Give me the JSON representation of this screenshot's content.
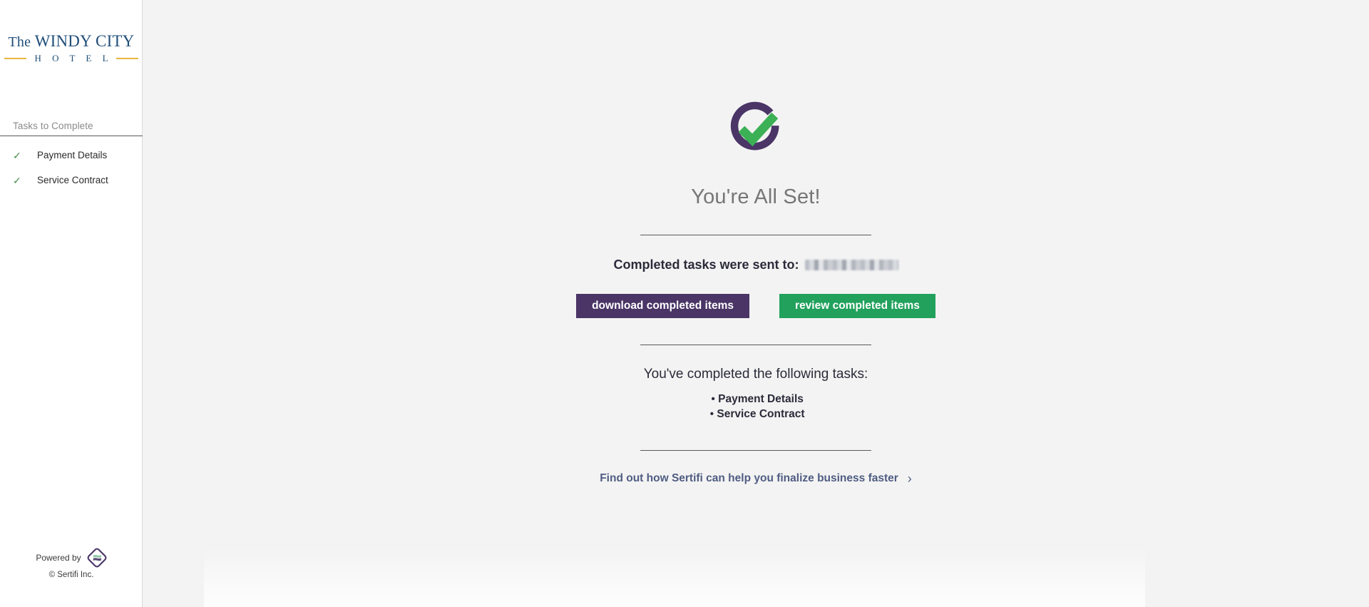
{
  "sidebar": {
    "brand": {
      "the": "The",
      "name": "WINDY CITY",
      "subtitle": "H O T E L",
      "color": "#1f4e79",
      "rule_color": "#e8b73c"
    },
    "tasks_header": "Tasks to Complete",
    "items": [
      {
        "label": "Payment Details",
        "icon": "check-icon",
        "state": "completed"
      },
      {
        "label": "Service Contract",
        "icon": "check-icon",
        "state": "completed"
      }
    ],
    "footer": {
      "powered_by": "Powered by",
      "logo_name": "sertifi-logo-icon",
      "copyright": "© Sertifi Inc."
    }
  },
  "main": {
    "status_icon": "circle-check-icon",
    "headline": "You're All Set!",
    "sent_to_label": "Completed tasks were sent to:",
    "sent_to_value": "",
    "buttons": {
      "download": {
        "label": "download completed items",
        "color": "#4a3566"
      },
      "review": {
        "label": "review completed items",
        "color": "#21a15c"
      }
    },
    "completed_title": "You've completed the following tasks:",
    "completed_items": [
      "Payment Details",
      "Service Contract"
    ],
    "promo": {
      "text": "Find out how Sertifi can help you finalize business faster",
      "chevron": "›",
      "color": "#4f5d82"
    }
  }
}
